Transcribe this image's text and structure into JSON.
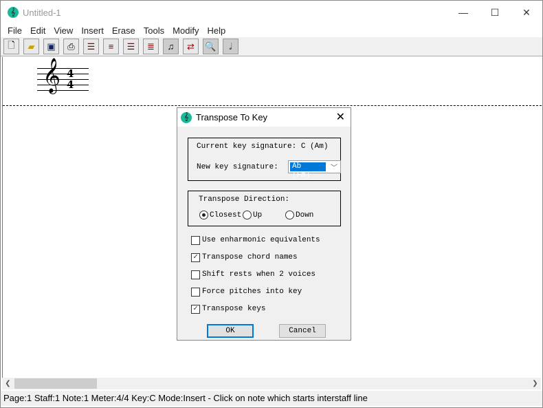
{
  "window": {
    "title": "Untitled-1",
    "controls": [
      "minimize",
      "maximize",
      "close"
    ]
  },
  "menu": [
    "File",
    "Edit",
    "View",
    "Insert",
    "Erase",
    "Tools",
    "Modify",
    "Help"
  ],
  "toolbar": [
    "new-file",
    "open-folder",
    "save",
    "print",
    "page-layout-1",
    "page-layout-2",
    "page-layout-3",
    "page-layout-4",
    "note",
    "transpose",
    "zoom",
    "half-note"
  ],
  "score": {
    "time_signature_top": "4",
    "time_signature_bottom": "4"
  },
  "status": "Page:1 Staff:1 Note:1  Meter:4/4  Key:C  Mode:Insert - Click on note which starts interstaff line",
  "dialog": {
    "title": "Transpose To Key",
    "current_key": "Current key signature: C (Am)",
    "new_key_label": "New key signature:",
    "new_key_value": "Ab (Fm)",
    "direction_label": "Transpose Direction:",
    "directions": {
      "closest": "Closest",
      "up": "Up",
      "down": "Down",
      "selected": "Closest"
    },
    "options": [
      {
        "label": "Use enharmonic equivalents",
        "checked": false
      },
      {
        "label": "Transpose chord names",
        "checked": true
      },
      {
        "label": "Shift rests when 2 voices",
        "checked": false
      },
      {
        "label": "Force pitches into key",
        "checked": false
      },
      {
        "label": "Transpose keys",
        "checked": true
      }
    ],
    "ok": "OK",
    "cancel": "Cancel"
  }
}
